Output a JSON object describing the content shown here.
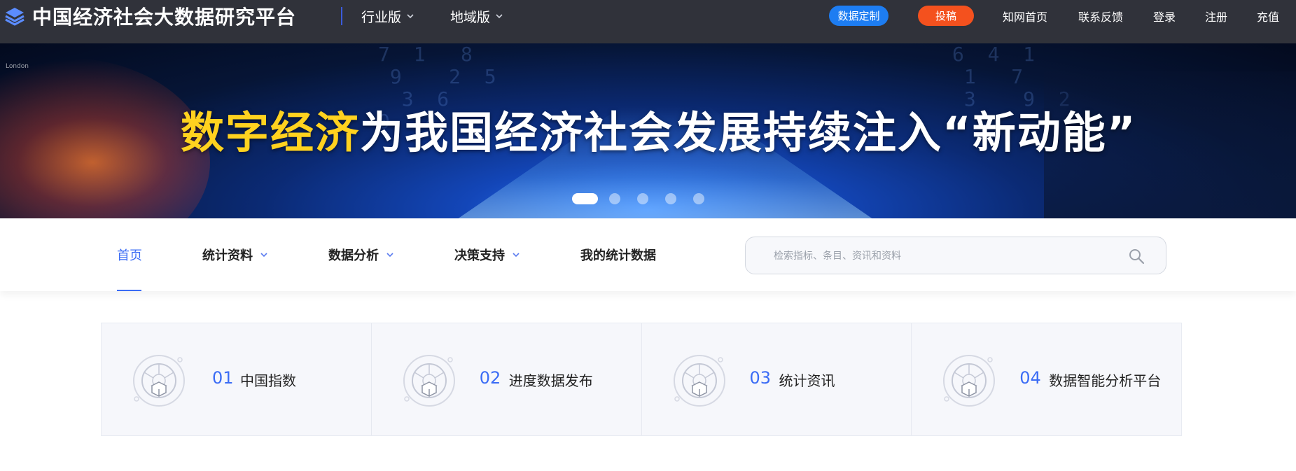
{
  "header": {
    "title": "中国经济社会大数据研究平台",
    "editions": [
      {
        "label": "行业版"
      },
      {
        "label": "地域版"
      }
    ],
    "btn_custom": "数据定制",
    "btn_submit": "投稿",
    "links": [
      {
        "label": "知网首页"
      },
      {
        "label": "联系反馈"
      },
      {
        "label": "登录"
      },
      {
        "label": "注册"
      },
      {
        "label": "充值"
      }
    ]
  },
  "banner": {
    "tag": "London",
    "headline_highlight": "数字经济",
    "headline_rest": "为我国经济社会发展持续注入“新动能”",
    "slide_count": 5,
    "active_slide": 1
  },
  "nav": {
    "items": [
      {
        "label": "首页",
        "active": true
      },
      {
        "label": "统计资料",
        "has_dropdown": true
      },
      {
        "label": "数据分析",
        "has_dropdown": true
      },
      {
        "label": "决策支持",
        "has_dropdown": true
      },
      {
        "label": "我的统计数据"
      }
    ],
    "search_placeholder": "检索指标、条目、资讯和资料"
  },
  "features": [
    {
      "num": "01",
      "label": "中国指数"
    },
    {
      "num": "02",
      "label": "进度数据发布"
    },
    {
      "num": "03",
      "label": "统计资讯"
    },
    {
      "num": "04",
      "label": "数据智能分析平台"
    }
  ],
  "colors": {
    "accent": "#3b6cf5",
    "topbar": "#30323a",
    "btn_custom": "#1d7df2",
    "btn_submit": "#f4511e",
    "headline_highlight": "#ffd21f"
  }
}
